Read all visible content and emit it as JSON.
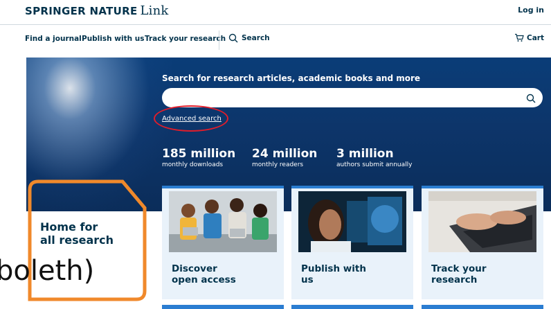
{
  "header": {
    "logo_brand": "SPRINGER NATURE",
    "logo_suffix": "Link",
    "login_label": "Log in"
  },
  "nav": {
    "items": [
      "Find a journal",
      "Publish with us",
      "Track your research"
    ],
    "search_label": "Search",
    "cart_label": "Cart"
  },
  "hero": {
    "search_heading": "Search for research articles, academic books and more",
    "search_value": "",
    "advanced_search_label": "Advanced search",
    "stats": [
      {
        "number": "185 million",
        "label": "monthly downloads"
      },
      {
        "number": "24 million",
        "label": "monthly readers"
      },
      {
        "number": "3 million",
        "label": "authors submit annually"
      }
    ]
  },
  "promo": {
    "home_for_line1": "Home for",
    "home_for_line2": "all research"
  },
  "cards": [
    {
      "title_line1": "Discover",
      "title_line2": "open access"
    },
    {
      "title_line1": "Publish with",
      "title_line2": "us"
    },
    {
      "title_line1": "Track your",
      "title_line2": "research"
    }
  ],
  "overlay_text": "boleth)",
  "colors": {
    "brand_navy": "#01324b",
    "hero_blue": "#0d356a",
    "card_bg": "#e9f2fa",
    "accent_blue": "#2b7dd1",
    "annotation_red": "#e21d2a",
    "annotation_orange": "#f0892b"
  },
  "icons": [
    "search-icon",
    "cart-icon"
  ]
}
